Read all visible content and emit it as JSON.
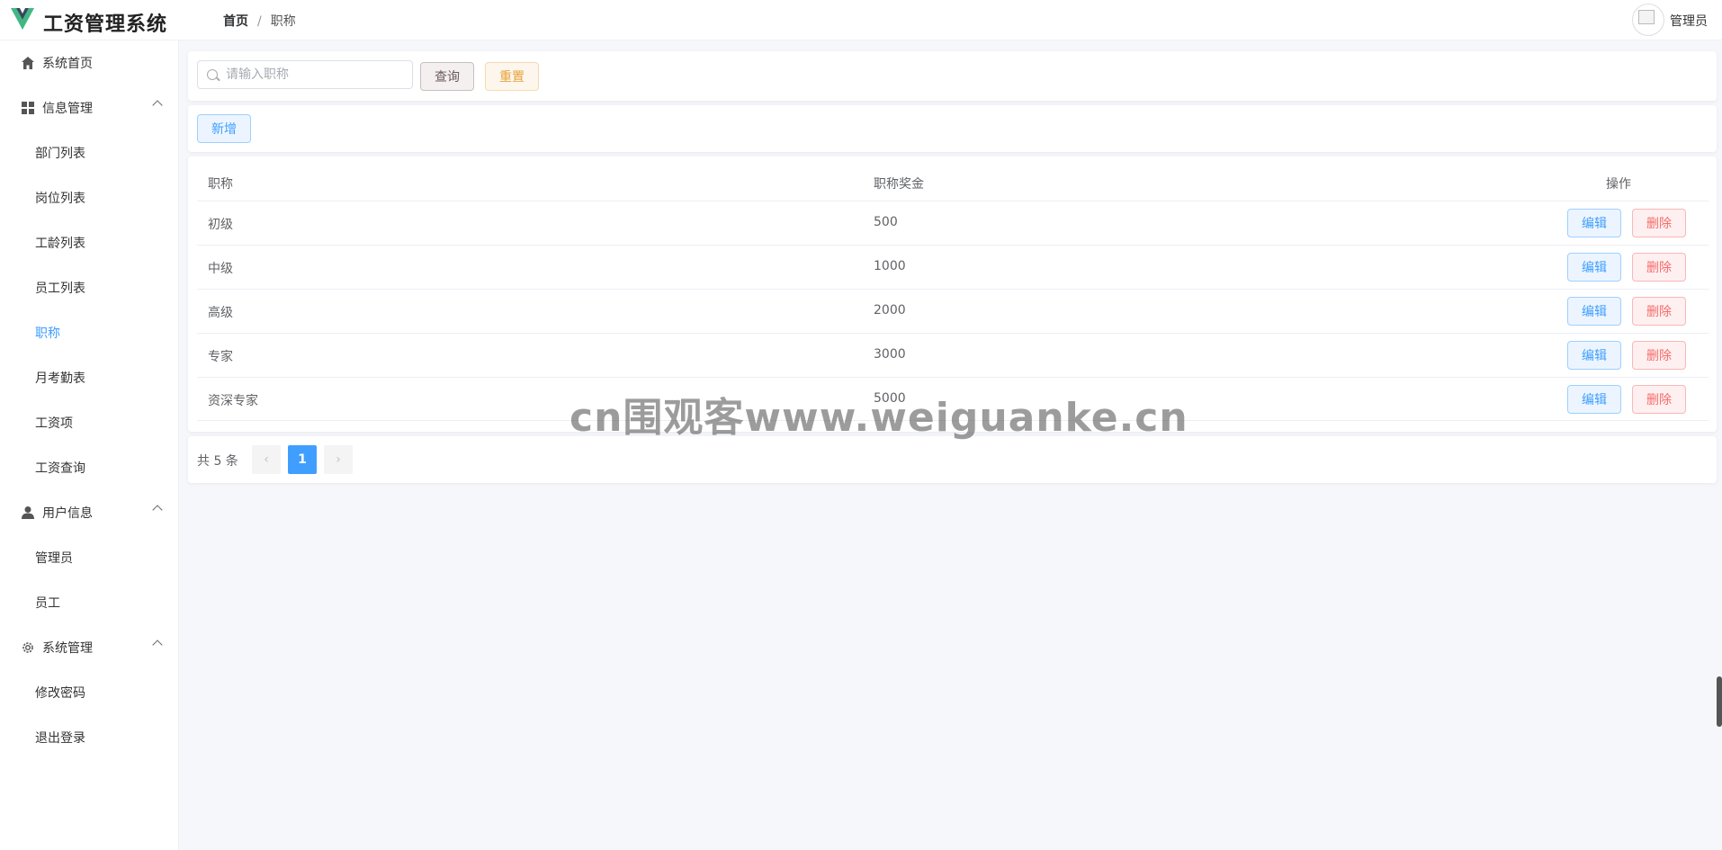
{
  "header": {
    "app_title": "工资管理系统",
    "breadcrumb_home": "首页",
    "breadcrumb_sep": "/",
    "breadcrumb_current": "职称",
    "user_name": "管理员"
  },
  "sidebar": {
    "home": "系统首页",
    "info_group": "信息管理",
    "info_items": [
      "部门列表",
      "岗位列表",
      "工龄列表",
      "员工列表",
      "职称",
      "月考勤表",
      "工资项",
      "工资查询"
    ],
    "user_group": "用户信息",
    "user_items": [
      "管理员",
      "员工"
    ],
    "system_group": "系统管理",
    "system_items": [
      "修改密码",
      "退出登录"
    ],
    "active_item": "职称"
  },
  "search": {
    "placeholder": "请输入职称",
    "query_label": "查询",
    "reset_label": "重置"
  },
  "toolbar": {
    "add_label": "新增"
  },
  "table": {
    "columns": [
      "职称",
      "职称奖金",
      "操作"
    ],
    "rows": [
      {
        "title": "初级",
        "bonus": "500"
      },
      {
        "title": "中级",
        "bonus": "1000"
      },
      {
        "title": "高级",
        "bonus": "2000"
      },
      {
        "title": "专家",
        "bonus": "3000"
      },
      {
        "title": "资深专家",
        "bonus": "5000"
      }
    ],
    "edit_label": "编辑",
    "delete_label": "删除"
  },
  "pagination": {
    "total_text": "共 5 条",
    "current_page": "1",
    "prev": "‹",
    "next": "›"
  },
  "watermark": "cn围观客www.weiguanke.cn",
  "colors": {
    "primary": "#409eff",
    "danger": "#f56c6c",
    "warning": "#e6a23c"
  }
}
